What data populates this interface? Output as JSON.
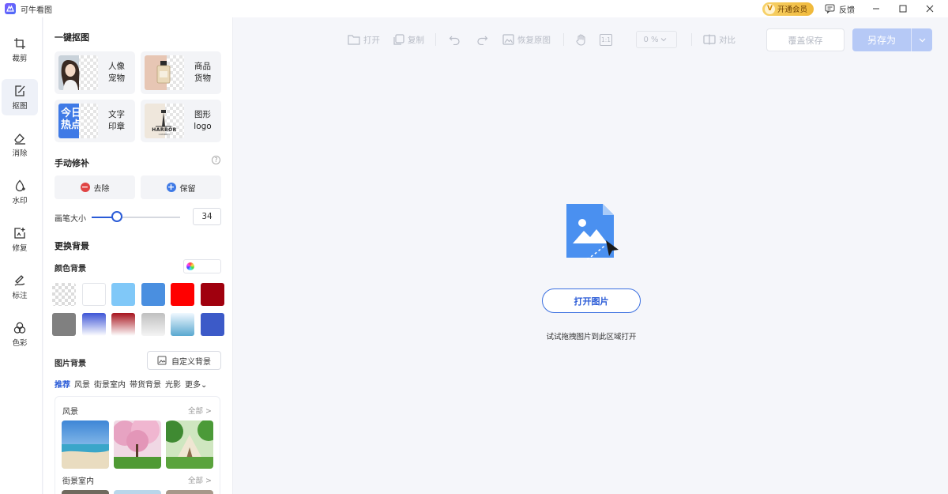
{
  "titlebar": {
    "app_name": "可牛看图",
    "vip_label": "开通会员",
    "vip_badge": "V",
    "feedback_label": "反馈"
  },
  "rail": {
    "items": [
      {
        "label": "裁剪",
        "icon": "crop-icon"
      },
      {
        "label": "抠图",
        "icon": "cutout-icon",
        "active": true
      },
      {
        "label": "消除",
        "icon": "eraser-icon"
      },
      {
        "label": "水印",
        "icon": "watermark-icon"
      },
      {
        "label": "修复",
        "icon": "repair-icon"
      },
      {
        "label": "标注",
        "icon": "annotate-icon"
      },
      {
        "label": "色彩",
        "icon": "color-icon"
      }
    ]
  },
  "panel": {
    "one_click_title": "一键抠图",
    "cards": [
      {
        "line1": "人像",
        "line2": "宠物"
      },
      {
        "line1": "商品",
        "line2": "货物"
      },
      {
        "line1": "文字",
        "line2": "印章"
      },
      {
        "line1": "图形",
        "line2": "logo"
      }
    ],
    "thumb_text_card": {
      "line1": "今日",
      "line2": "热点"
    },
    "thumb_logo_card": {
      "brand": "HARBOR",
      "sub": "COMPANY"
    },
    "manual_title": "手动修补",
    "help_glyph": "?",
    "remove_label": "去除",
    "keep_label": "保留",
    "brush_label": "画笔大小",
    "brush_value": "34",
    "brush_fraction": 0.29,
    "change_bg_title": "更换背景",
    "color_bg_label": "颜色背景",
    "swatches": [
      "transparent",
      "#ffffff",
      "#80c8f8",
      "#4a8fe0",
      "#ff0000",
      "#a0000e",
      "#808080",
      "linear-gradient(#3e55d6,#ffffff)",
      "linear-gradient(#a8151f,#ffffff)",
      "linear-gradient(#c0c0c0,#f4f4f4)",
      "linear-gradient(#f0f8ff,#5aa8d0)",
      "#3c5ac8"
    ],
    "image_bg_label": "图片背景",
    "custom_bg_label": "自定义背景",
    "tabs": [
      "推荐",
      "风景",
      "街景室内",
      "带货背景",
      "光影",
      "更多"
    ],
    "more_arrow": "⌄",
    "group1_title": "风景",
    "group2_title": "街景室内",
    "all_label": "全部 >"
  },
  "toolbar": {
    "open": "打开",
    "copy": "复制",
    "restore": "恢复原图",
    "ratio": "1:1",
    "zoom": "0",
    "zoom_unit": "%",
    "compare": "对比",
    "save": "覆盖保存",
    "save_as": "另存为"
  },
  "main": {
    "open_image": "打开图片",
    "hint": "试试拖拽图片到此区域打开"
  },
  "colors": {
    "accent": "#2a5bd7",
    "vip_gold": "#f4c64a",
    "save_as_bg": "#b6c9f6"
  }
}
